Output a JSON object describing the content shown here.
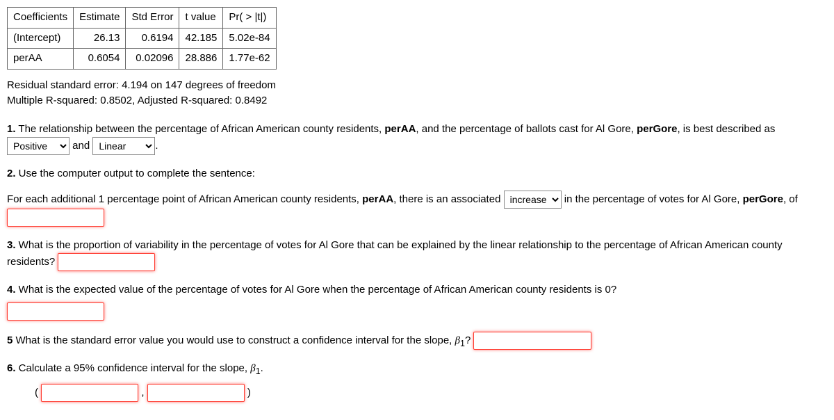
{
  "table": {
    "headers": [
      "Coefficients",
      "Estimate",
      "Std Error",
      "t value",
      "Pr( > |t|)"
    ],
    "rows": [
      {
        "label": "(Intercept)",
        "estimate": "26.13",
        "se": "0.6194",
        "t": "42.185",
        "p": "5.02e-84"
      },
      {
        "label": "perAA",
        "estimate": "0.6054",
        "se": "0.02096",
        "t": "28.886",
        "p": "1.77e-62"
      }
    ]
  },
  "stats": {
    "line1": "Residual standard error: 4.194 on 147 degrees of freedom",
    "line2": "Multiple R-squared: 0.8502, Adjusted R-squared: 0.8492"
  },
  "q1": {
    "prefix": "1.",
    "text_a": " The relationship between the percentage of African American county residents, ",
    "perAA": "perAA",
    "text_b": ", and the percentage of ballots cast for Al Gore, ",
    "perGore": "perGore",
    "text_c": ", is best described as ",
    "sel1_value": "Positive",
    "and": " and ",
    "sel2_value": "Linear",
    "end": "."
  },
  "q2": {
    "prefix": "2.",
    "heading": " Use the computer output to complete the sentence:",
    "text_a": "For each additional 1 percentage point of African American county residents, ",
    "perAA": "perAA",
    "text_b": ", there is an associated ",
    "sel_value": "increase",
    "text_c": " in the percentage of votes for Al Gore, ",
    "perGore": "perGore",
    "text_d": ", of "
  },
  "q3": {
    "prefix": "3.",
    "text": " What is the proportion of variability in the percentage of votes for Al Gore that can be explained by the linear relationship to the percentage of African American county residents? "
  },
  "q4": {
    "prefix": "4.",
    "text": " What is the expected value of the percentage of votes for Al Gore when the percentage of African American county residents is 0?"
  },
  "q5": {
    "prefix": "5",
    "text_a": " What is the standard error value you would use to construct a confidence interval for the slope, ",
    "beta": "β",
    "sub": "1",
    "text_b": "? "
  },
  "q6": {
    "prefix": "6.",
    "text_a": " Calculate a 95% confidence interval for the slope, ",
    "beta": "β",
    "sub": "1",
    "text_b": ".",
    "lparen": "(",
    "comma": " , ",
    "rparen": ")"
  }
}
